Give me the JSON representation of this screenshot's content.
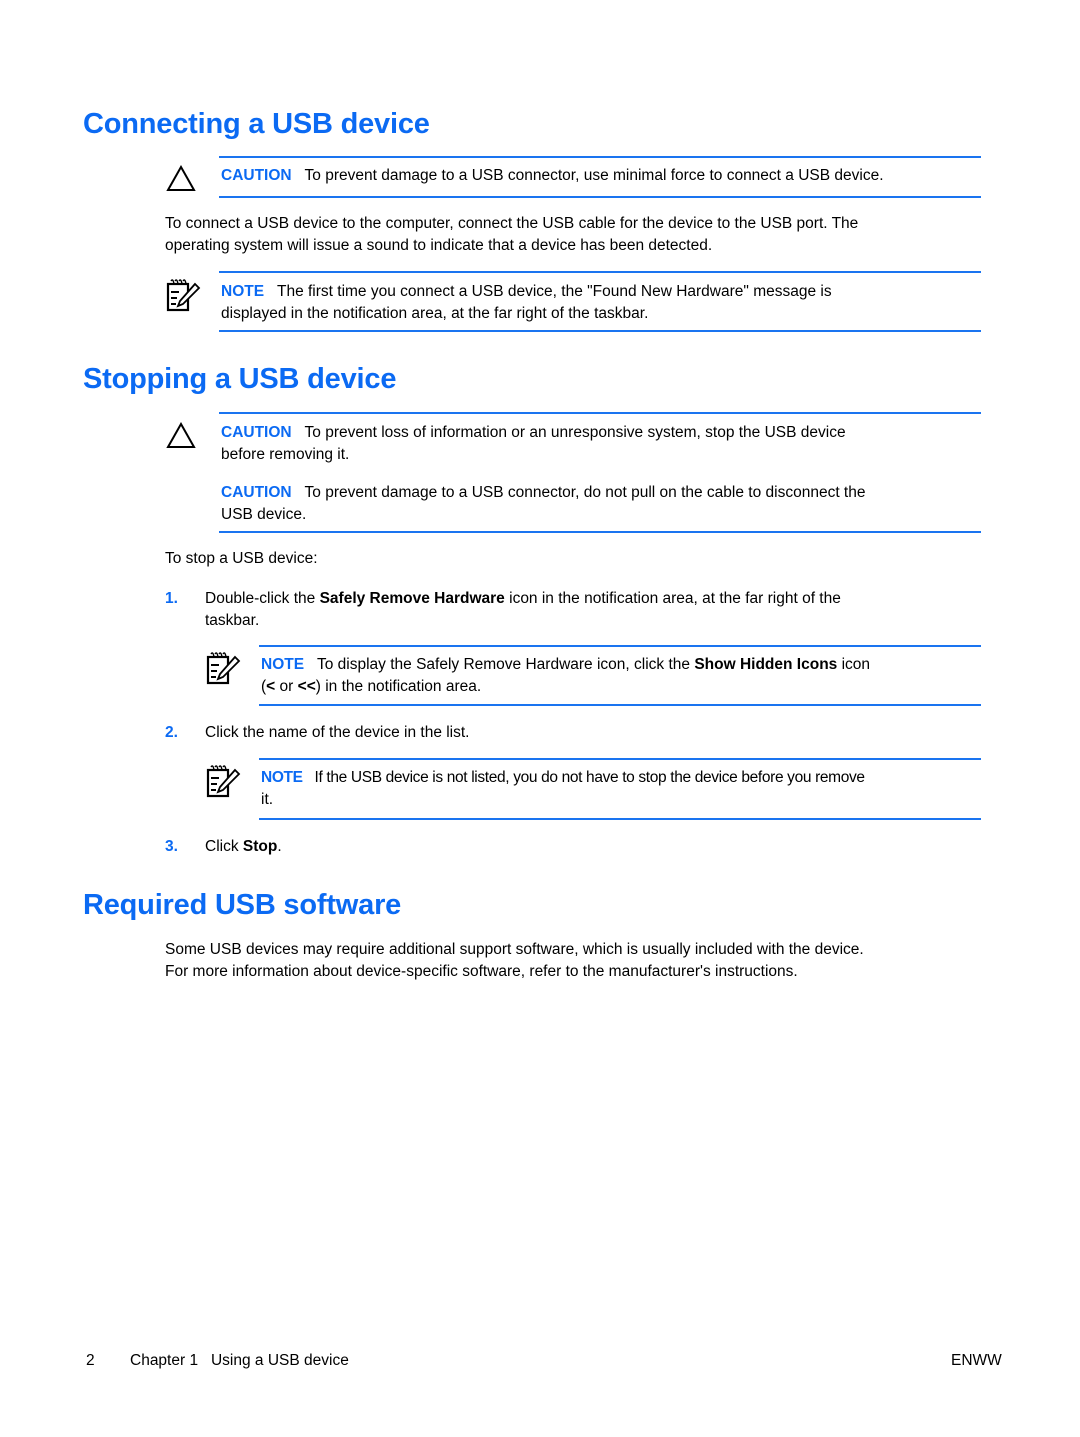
{
  "sections": {
    "connecting": {
      "title": "Connecting a USB device",
      "caution": {
        "label": "CAUTION",
        "text": "To prevent damage to a USB connector, use minimal force to connect a USB device."
      },
      "para_line1": "To connect a USB device to the computer, connect the USB cable for the device to the USB port. The",
      "para_line2": "operating system will issue a sound to indicate that a device has been detected.",
      "note": {
        "label": "NOTE",
        "line1": "The first time you connect a USB device, the \"Found New Hardware\" message is",
        "line2": "displayed in the notification area, at the far right of the taskbar."
      }
    },
    "stopping": {
      "title": "Stopping a USB device",
      "caution1": {
        "label": "CAUTION",
        "line1": "To prevent loss of information or an unresponsive system, stop the USB device",
        "line2": "before removing it."
      },
      "caution2": {
        "label": "CAUTION",
        "line1": "To prevent damage to a USB connector, do not pull on the cable to disconnect the",
        "line2": "USB device."
      },
      "intro": "To stop a USB device:",
      "steps": [
        {
          "num": "1.",
          "pre": "Double-click the ",
          "bold": "Safely Remove Hardware",
          "post": " icon in the notification area, at the far right of the",
          "line2": "taskbar."
        },
        {
          "num": "2.",
          "text": "Click the name of the device in the list."
        },
        {
          "num": "3.",
          "pre": "Click ",
          "bold": "Stop",
          "post": "."
        }
      ],
      "note1": {
        "label": "NOTE",
        "pre": "To display the Safely Remove Hardware icon, click the ",
        "bold": "Show Hidden Icons",
        "post": " icon",
        "line2_open": "(",
        "line2_b1": "<",
        "line2_or": " or ",
        "line2_b2": "<<",
        "line2_rest": ") in the notification area."
      },
      "note2": {
        "label": "NOTE",
        "line1": "If the USB device is not listed, you do not have to stop the device before you remove",
        "line2": "it."
      }
    },
    "software": {
      "title": "Required USB software",
      "line1": "Some USB devices may require additional support software, which is usually included with the device.",
      "line2": "For more information about device-specific software, refer to the manufacturer's instructions."
    }
  },
  "footer": {
    "page_number": "2",
    "chapter": "Chapter 1   Using a USB device",
    "locale": "ENWW"
  },
  "icons": {
    "caution": "warning-triangle-icon",
    "note": "note-pencil-icon"
  },
  "colors": {
    "accent": "#0b6af3",
    "rule": "#1a74f0"
  }
}
